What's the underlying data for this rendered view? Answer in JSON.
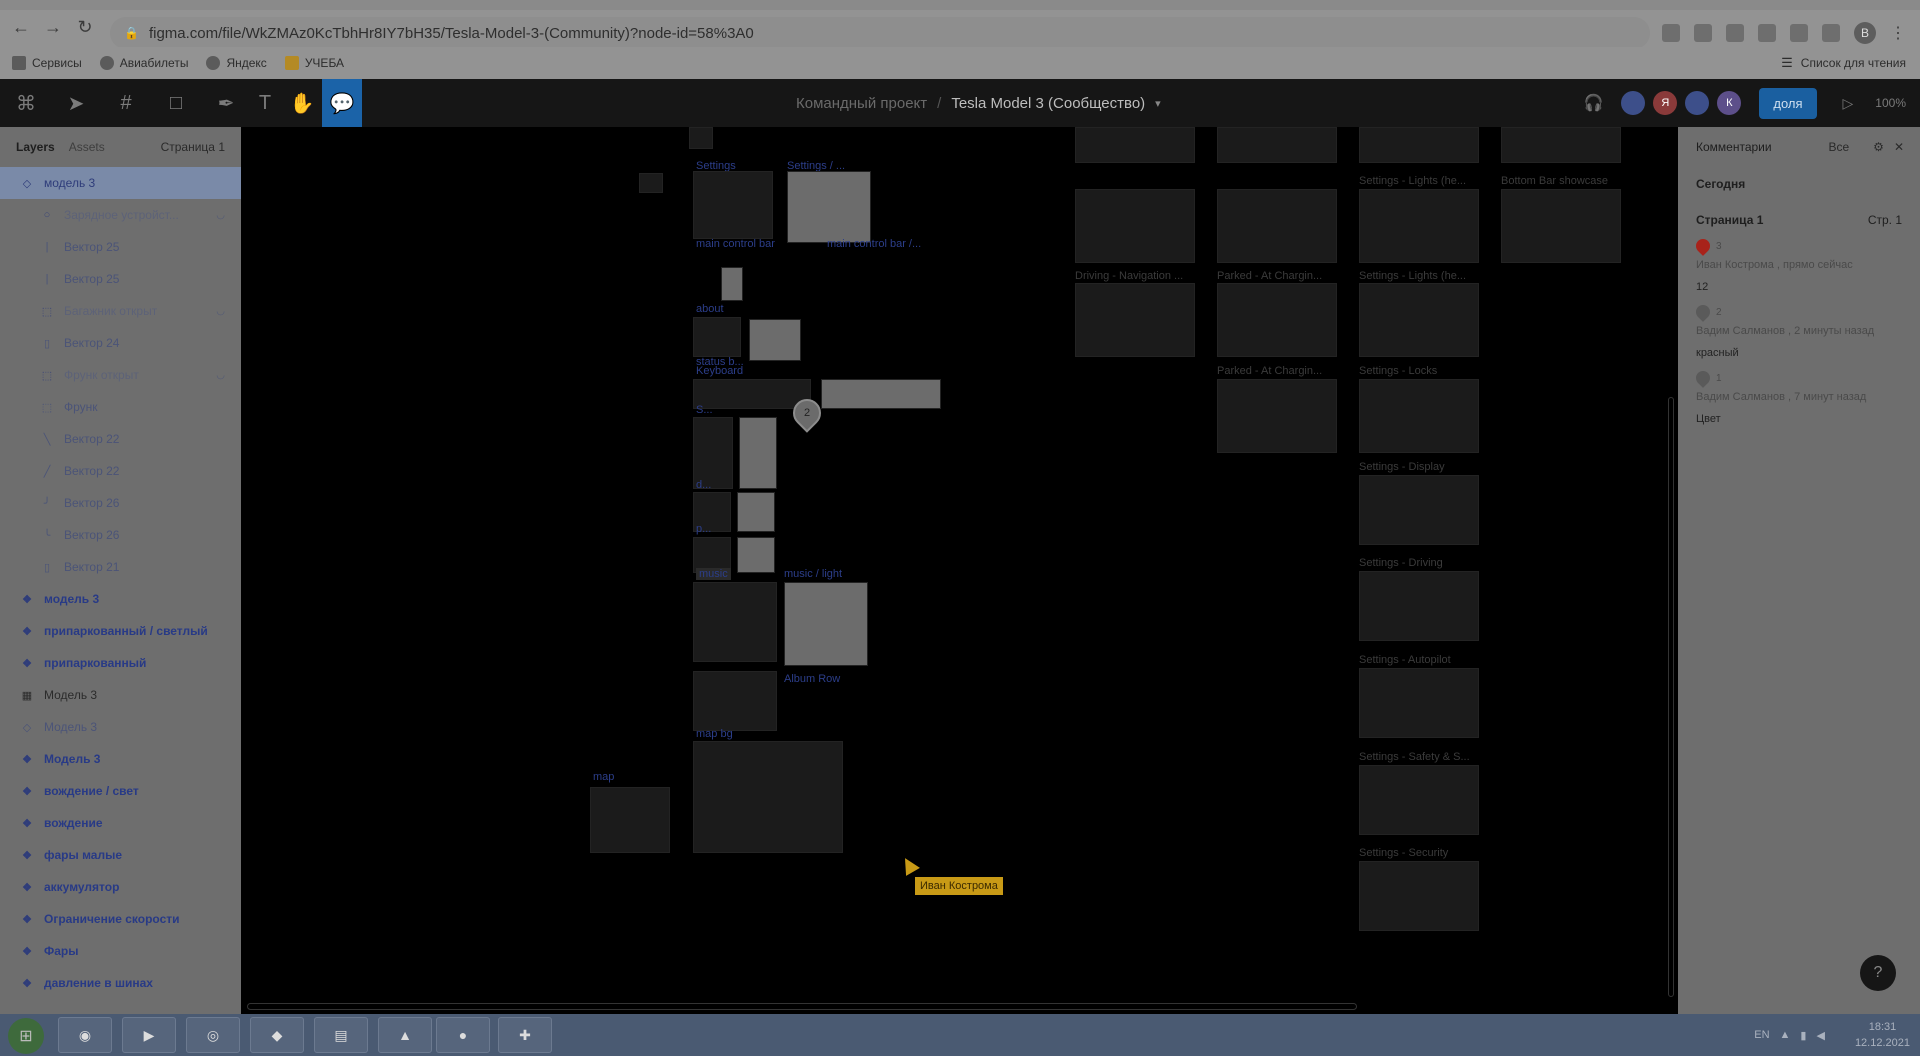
{
  "browser": {
    "url": "figma.com/file/WkZMAz0KcTbhHr8IY7bH35/Tesla-Model-3-(Community)?node-id=58%3A0",
    "profile_initial": "B",
    "bookmarks": [
      {
        "label": "Сервисы",
        "icon": "apps-icon"
      },
      {
        "label": "Авиабилеты",
        "icon": "globe-icon"
      },
      {
        "label": "Яндекс",
        "icon": "globe-icon"
      },
      {
        "label": "УЧЕБА",
        "icon": "folder-icon"
      }
    ],
    "reading_list": "Список для чтения"
  },
  "figma": {
    "team": "Командный проект",
    "file": "Tesla Model 3 (Сообщество)",
    "share_label": "доля",
    "zoom": "100%",
    "avatars": [
      {
        "letter": "",
        "color": "#3d4f8a"
      },
      {
        "letter": "Я",
        "color": "#8a3a3a"
      },
      {
        "letter": "",
        "color": "#3d4f8a"
      },
      {
        "letter": "К",
        "color": "#5d4f8a"
      }
    ]
  },
  "layers_panel": {
    "tab_layers": "Layers",
    "tab_assets": "Assets",
    "page": "Страница 1",
    "items": [
      {
        "label": "модель 3",
        "kind": "sel",
        "icon": "◇"
      },
      {
        "label": "Зарядное устройст...",
        "kind": "child muted",
        "icon": "○"
      },
      {
        "label": "Вектор 25",
        "kind": "child dim",
        "icon": "|"
      },
      {
        "label": "Вектор 25",
        "kind": "child dim",
        "icon": "|"
      },
      {
        "label": "Багажник открыт",
        "kind": "child muted",
        "icon": "⬚"
      },
      {
        "label": "Вектор 24",
        "kind": "child dim",
        "icon": "▯"
      },
      {
        "label": "Фрунк открыт",
        "kind": "child muted",
        "icon": "⬚"
      },
      {
        "label": "Фрунк",
        "kind": "child dim",
        "icon": "⬚"
      },
      {
        "label": "Вектор 22",
        "kind": "child dim",
        "icon": "╲"
      },
      {
        "label": "Вектор 22",
        "kind": "child dim",
        "icon": "╱"
      },
      {
        "label": "Вектор 26",
        "kind": "child dim",
        "icon": "╯"
      },
      {
        "label": "Вектор 26",
        "kind": "child dim",
        "icon": "╰"
      },
      {
        "label": "Вектор 21",
        "kind": "child dim",
        "icon": "▯"
      },
      {
        "label": "модель 3",
        "kind": "comp",
        "icon": "❖"
      },
      {
        "label": "припаркованный / светлый",
        "kind": "comp",
        "icon": "❖"
      },
      {
        "label": "припаркованный",
        "kind": "comp",
        "icon": "❖"
      },
      {
        "label": "Модель 3",
        "kind": "frame",
        "icon": "▦"
      },
      {
        "label": "Модель 3",
        "kind": "dim",
        "icon": "◇"
      },
      {
        "label": "Модель 3",
        "kind": "comp",
        "icon": "❖"
      },
      {
        "label": "вождение / свет",
        "kind": "comp",
        "icon": "❖"
      },
      {
        "label": "вождение",
        "kind": "comp",
        "icon": "❖"
      },
      {
        "label": "фары малые",
        "kind": "comp",
        "icon": "❖"
      },
      {
        "label": "аккумулятор",
        "kind": "comp",
        "icon": "❖"
      },
      {
        "label": "Ограничение скорости",
        "kind": "comp",
        "icon": "❖"
      },
      {
        "label": "Фары",
        "kind": "comp",
        "icon": "❖"
      },
      {
        "label": "давление в шинах",
        "kind": "comp",
        "icon": "❖"
      }
    ]
  },
  "canvas": {
    "labels": {
      "settings": "Settings",
      "settings2": "Settings / ...",
      "main_control": "main control bar",
      "main_control2": "main control bar /...",
      "about": "about",
      "status": "status b...",
      "keyboard": "Keyboard",
      "s": "S...",
      "d": "d...",
      "p": "p...",
      "music": "music",
      "music_light": "music / light",
      "album_row": "Album Row",
      "map_bg": "map bg",
      "map": "map",
      "lights1": "Settings - Lights (he...",
      "bottom_bar": "Bottom Bar showcase",
      "driving_nav": "Driving - Navigation ...",
      "parked1": "Parked - At Chargin...",
      "lights2": "Settings - Lights (he...",
      "parked2": "Parked - At Chargin...",
      "locks": "Settings - Locks",
      "display": "Settings - Display",
      "driving": "Settings - Driving",
      "autopilot": "Settings - Autopilot",
      "safety": "Settings - Safety & S...",
      "security": "Settings - Security"
    },
    "pin_number": "2",
    "cursor_user": "Иван Кострома"
  },
  "comments_panel": {
    "title": "Комментарии",
    "filter": "Все",
    "today": "Сегодня",
    "page": "Страница 1",
    "page_num": "Стр. 1",
    "comments": [
      {
        "num": "3",
        "meta": "Иван Кострома , прямо сейчас",
        "body": "12",
        "red": true
      },
      {
        "num": "2",
        "meta": "Вадим Салманов , 2 минуты назад",
        "body": "красный",
        "red": false
      },
      {
        "num": "1",
        "meta": "Вадим Салманов , 7 минут назад",
        "body": "Цвет",
        "red": false
      }
    ]
  },
  "taskbar": {
    "lang": "EN",
    "time": "18:31",
    "date": "12.12.2021"
  }
}
